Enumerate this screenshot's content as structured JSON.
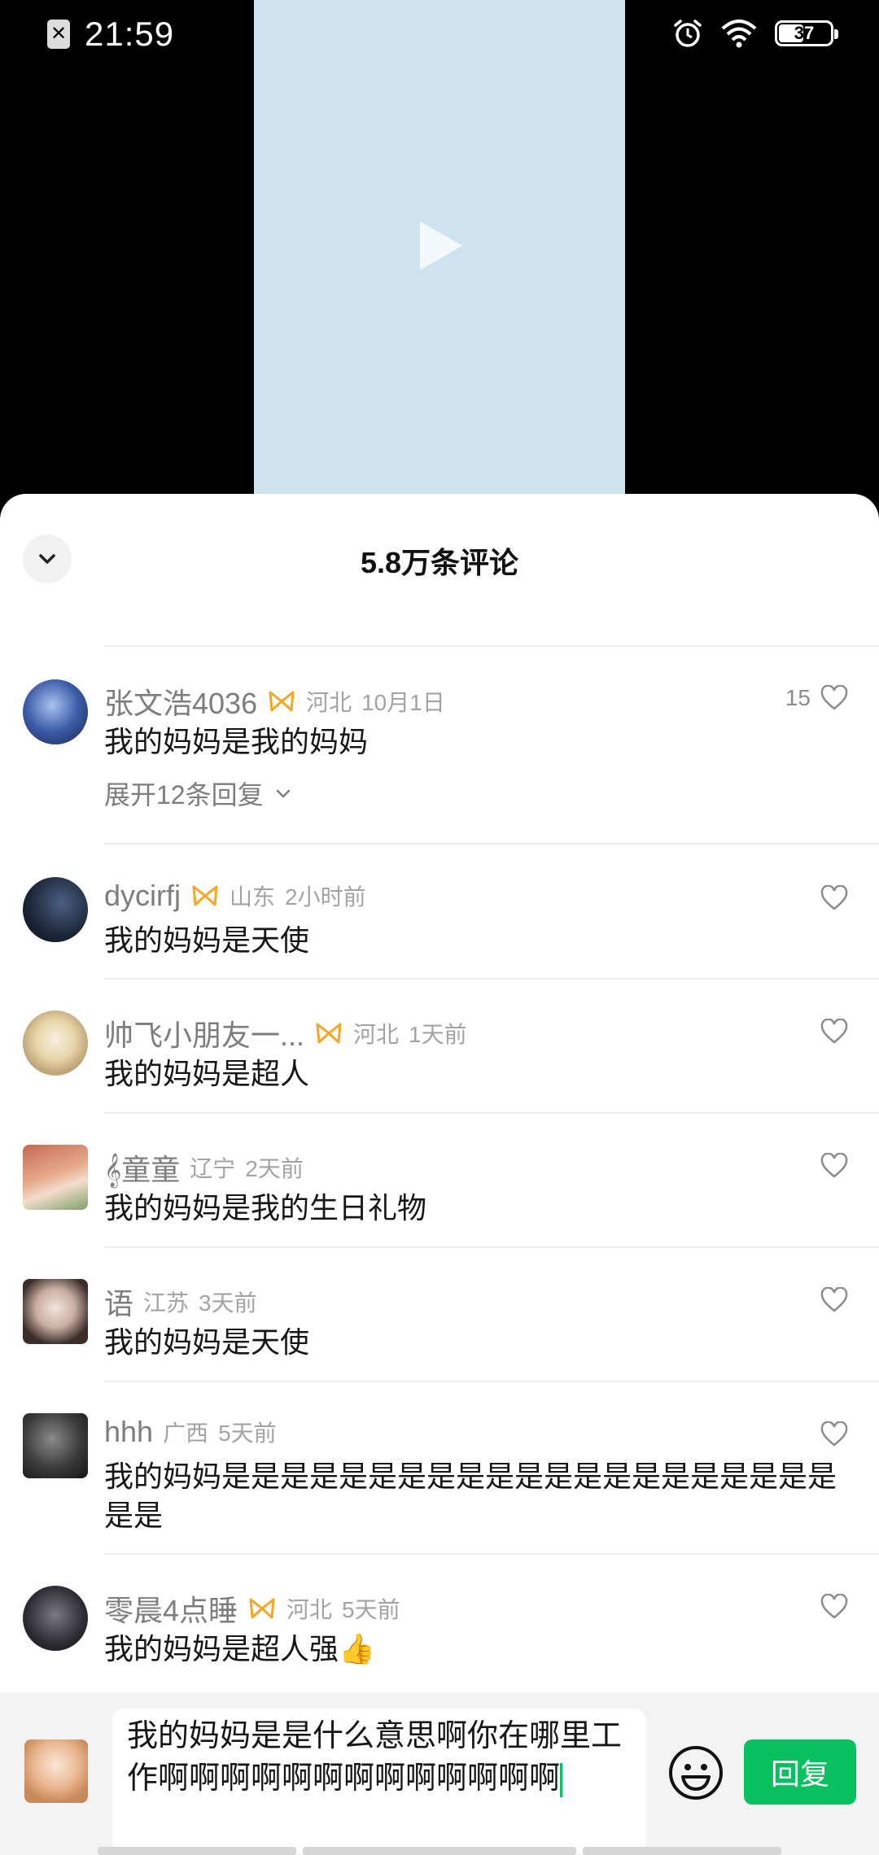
{
  "status_bar": {
    "time": "21:59",
    "battery": "37",
    "sim_icon": "✕"
  },
  "video": {
    "play_icon": "play-icon"
  },
  "sheet": {
    "title": "5.8万条评论"
  },
  "comments": [
    {
      "name": "张文浩4036",
      "region": "河北",
      "time": "10月1日",
      "text": "我的妈妈是我的妈妈",
      "likes": "15",
      "has_badge": true,
      "expand": "展开12条回复"
    },
    {
      "name": "dycirfj",
      "region": "山东",
      "time": "2小时前",
      "text": "我的妈妈是天使",
      "likes": "",
      "has_badge": true
    },
    {
      "name": "帅飞小朋友一...",
      "region": "河北",
      "time": "1天前",
      "text": "我的妈妈是超人",
      "likes": "",
      "has_badge": true
    },
    {
      "name": "𝄞童童",
      "region": "辽宁",
      "time": "2天前",
      "text": "我的妈妈是我的生日礼物",
      "likes": "",
      "has_badge": false
    },
    {
      "name": "语",
      "region": "江苏",
      "time": "3天前",
      "text": "我的妈妈是天使",
      "likes": "",
      "has_badge": false
    },
    {
      "name": "hhh",
      "region": "广西",
      "time": "5天前",
      "text": "我的妈妈是是是是是是是是是是是是是是是是是是是是是是是",
      "likes": "",
      "has_badge": false
    },
    {
      "name": "零晨4点睡",
      "region": "河北",
      "time": "5天前",
      "text": "我的妈妈是超人强👍",
      "likes": "",
      "has_badge": true
    }
  ],
  "reply_bar": {
    "input_value": "我的妈妈是是什么意思啊你在哪里工作啊啊啊啊啊啊啊啊啊啊啊啊啊",
    "send_label": "回复"
  },
  "colors": {
    "accent": "#07c160",
    "badge": "#f5a623",
    "text": "#161616",
    "meta": "#a3a3a3"
  }
}
